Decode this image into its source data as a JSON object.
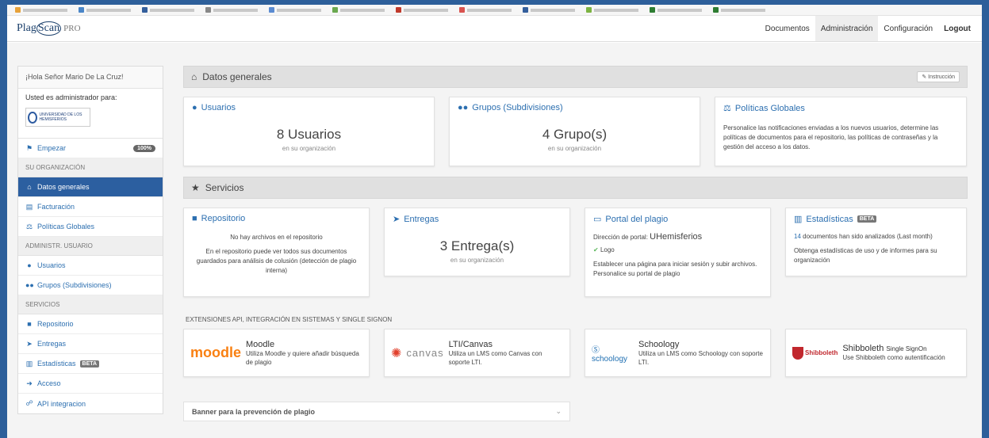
{
  "app": {
    "logo": "Plag",
    "logo_scan": "Scan",
    "logo_pro": "PRO"
  },
  "nav": {
    "documentos": "Documentos",
    "administracion": "Administración",
    "configuracion": "Configuración",
    "logout": "Logout"
  },
  "sidebar": {
    "greeting": "¡Hola Señor Mario De La Cruz!",
    "admin_for": "Usted es administrador para:",
    "seal_text": "UNIVERSIDAD DE LOS HEMISFERIOS",
    "empezar": "Empezar",
    "empezar_badge": "100%",
    "section_org": "SU ORGANIZACIÓN",
    "datos_generales": "Datos generales",
    "facturacion": "Facturación",
    "politicas": "Políticas Globales",
    "section_admin": "ADMINISTR. USUARIO",
    "usuarios": "Usuarios",
    "grupos": "Grupos (Subdivisiones)",
    "section_servicios": "SERVICIOS",
    "repositorio": "Repositorio",
    "entregas": "Entregas",
    "estadisticas": "Estadísticas",
    "beta": "BETA",
    "acceso": "Acceso",
    "api": "API integracion"
  },
  "datos": {
    "title": "Datos generales",
    "instruccion": "Instrucción",
    "usuarios": {
      "title": "Usuarios",
      "count": "8 Usuarios",
      "sub": "en su organización"
    },
    "grupos": {
      "title": "Grupos (Subdivisiones)",
      "count": "4 Grupo(s)",
      "sub": "en su organización"
    },
    "politicas": {
      "title": "Políticas Globales",
      "desc": "Personalice las notificaciones enviadas a los nuevos usuarios, determine las políticas de documentos para el repositorio, las políticas de contraseñas y la gestión del acceso a los datos."
    }
  },
  "servicios": {
    "title": "Servicios",
    "repositorio": {
      "title": "Repositorio",
      "empty": "No hay archivos en el repositorio",
      "desc": "En el repositorio puede ver todos sus documentos guardados para análisis de colusión (detección de plagio interna)"
    },
    "entregas": {
      "title": "Entregas",
      "count": "3 Entrega(s)",
      "sub": "en su organización"
    },
    "portal": {
      "title": "Portal del plagio",
      "dir_label": "Dirección de portal:",
      "dir_value": "UHemisferios",
      "logo": "Logo",
      "desc": "Establecer una página para iniciar sesión y subir archivos. Personalice su portal de plagio"
    },
    "estadisticas": {
      "title": "Estadísticas",
      "beta": "BETA",
      "count_num": "14",
      "count_text": "documentos han sido analizados (Last month)",
      "desc": "Obtenga estadísticas de uso y de informes para su organización"
    }
  },
  "extensions": {
    "label": "EXTENSIONES API, INTEGRACIÓN EN SISTEMAS Y SINGLE SIGNON",
    "moodle": {
      "logo": "moodle",
      "name": "Moodle",
      "desc": "Utiliza Moodle y quiere añadir búsqueda de plagio"
    },
    "canvas": {
      "logo": "canvas",
      "name": "LTI/Canvas",
      "desc": "Utiliza un LMS como Canvas con soporte LTI."
    },
    "schoology": {
      "logo_s": "schoology",
      "name": "Schoology",
      "desc": "Utiliza un LMS como Schoology con soporte LTI."
    },
    "shibboleth": {
      "logo": "Shibboleth",
      "name": "Shibboleth",
      "name_sub": "Single SignOn",
      "desc": "Use Shibboleth como autentificación"
    }
  },
  "banner": {
    "label": "Banner para la prevención de plagio"
  },
  "colors": {
    "accent": "#2c6fb0",
    "active": "#2c5fa0",
    "frame": "#2d5f9a"
  }
}
